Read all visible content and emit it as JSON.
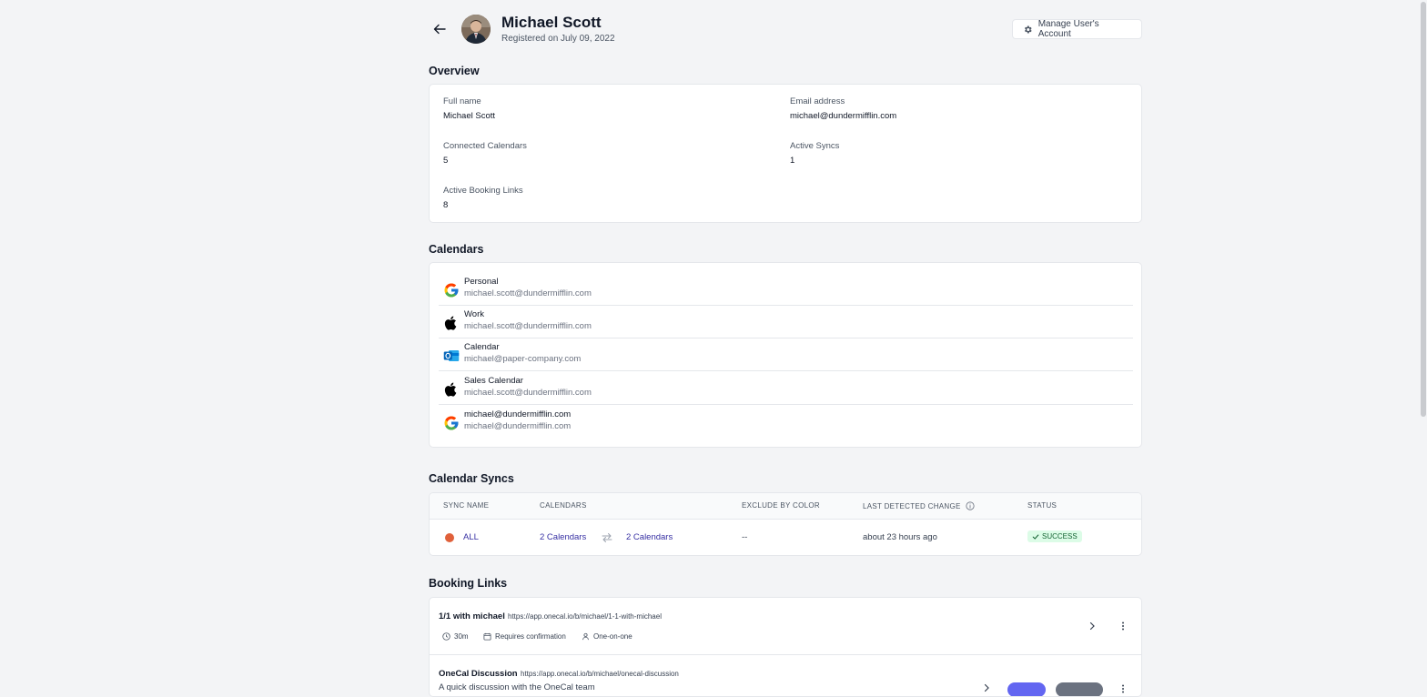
{
  "header": {
    "name": "Michael Scott",
    "registered": "Registered on July 09, 2022",
    "manage_label": "Manage User's Account"
  },
  "overview": {
    "title": "Overview",
    "full_name_label": "Full name",
    "full_name": "Michael Scott",
    "email_label": "Email address",
    "email": "michael@dundermifflin.com",
    "connected_label": "Connected Calendars",
    "connected": "5",
    "active_syncs_label": "Active Syncs",
    "active_syncs": "1",
    "booking_links_label": "Active Booking Links",
    "booking_links": "8"
  },
  "calendars": {
    "title": "Calendars",
    "items": [
      {
        "name": "Personal",
        "email": "michael.scott@dundermifflin.com",
        "provider": "google-icon"
      },
      {
        "name": "Work",
        "email": "michael.scott@dundermifflin.com",
        "provider": "apple-icon"
      },
      {
        "name": "Calendar",
        "email": "michael@paper-company.com",
        "provider": "outlook-icon"
      },
      {
        "name": "Sales Calendar",
        "email": "michael.scott@dundermifflin.com",
        "provider": "apple-icon"
      },
      {
        "name": "michael@dundermifflin.com",
        "email": "michael@dundermifflin.com",
        "provider": "google-icon"
      }
    ]
  },
  "syncs": {
    "title": "Calendar Syncs",
    "headers": [
      "Sync Name",
      "Calendars",
      "Exclude by color",
      "Last detected change",
      "Status"
    ],
    "rows": [
      {
        "color": "#e0603a",
        "name": "ALL",
        "from": "2 Calendars",
        "to": "2 Calendars",
        "exclude": "--",
        "last_change": "about 23 hours ago",
        "status": "SUCCESS"
      }
    ]
  },
  "booking": {
    "title": "Booking Links",
    "items": [
      {
        "title": "1/1 with michael",
        "url": "https://app.onecal.io/b/michael/1-1-with-michael",
        "duration": "30m",
        "confirmation": "Requires confirmation",
        "type": "One-on-one"
      },
      {
        "title": "OneCal Discussion",
        "url": "https://app.onecal.io/b/michael/onecal-discussion",
        "description": "A quick discussion with the OneCal team"
      }
    ]
  },
  "colors": {
    "accent": "#3730a3",
    "success_bg": "#dcfce7",
    "success_fg": "#166534",
    "sync_dot": "#e0603a"
  }
}
